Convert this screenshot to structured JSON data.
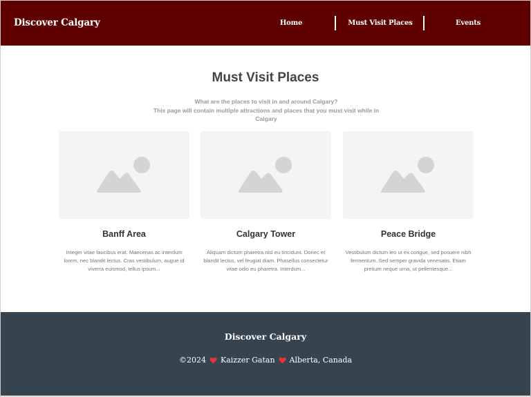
{
  "header": {
    "brand": "Discover Calgary",
    "nav": {
      "home": "Home",
      "places": "Must Visit Places",
      "events": "Events"
    },
    "color": "#5e0000"
  },
  "main": {
    "title": "Must Visit Places",
    "intro_line1": "What are the places to visit in and around Calgary?",
    "intro_line2": "This page will contain multiple attractions and places that you must visit while in Calgary",
    "cards": [
      {
        "title": "Banff Area",
        "icon": "image-placeholder-icon",
        "text": "Integer vitae faucibus erat. Maecenas ac interdum lorem, nec blandit lectus. Cras vestibulum, augue id viverra euismod, tellus ipsum..."
      },
      {
        "title": "Calgary Tower",
        "icon": "image-placeholder-icon",
        "text": "Aliquam dictum pharetra nisl eu tincidunt. Donec et blandit lectus, vel feugiat diam. Phasellus consectetur vitae odio eu pharetra. Interdum..."
      },
      {
        "title": "Peace Bridge",
        "icon": "image-placeholder-icon",
        "text": "Vestibulum dictum leo ut ex congue, sed posuere nibh fermentum. Sed semper gravida venenatis. Etiam pretium neque urna, ut pellentesque..."
      }
    ]
  },
  "footer": {
    "brand": "Discover Calgary",
    "copyright": "©2024",
    "author": "Kaizzer Gatan",
    "location": "Alberta, Canada",
    "heart_icon": "heart-icon",
    "color": "#36444f"
  }
}
